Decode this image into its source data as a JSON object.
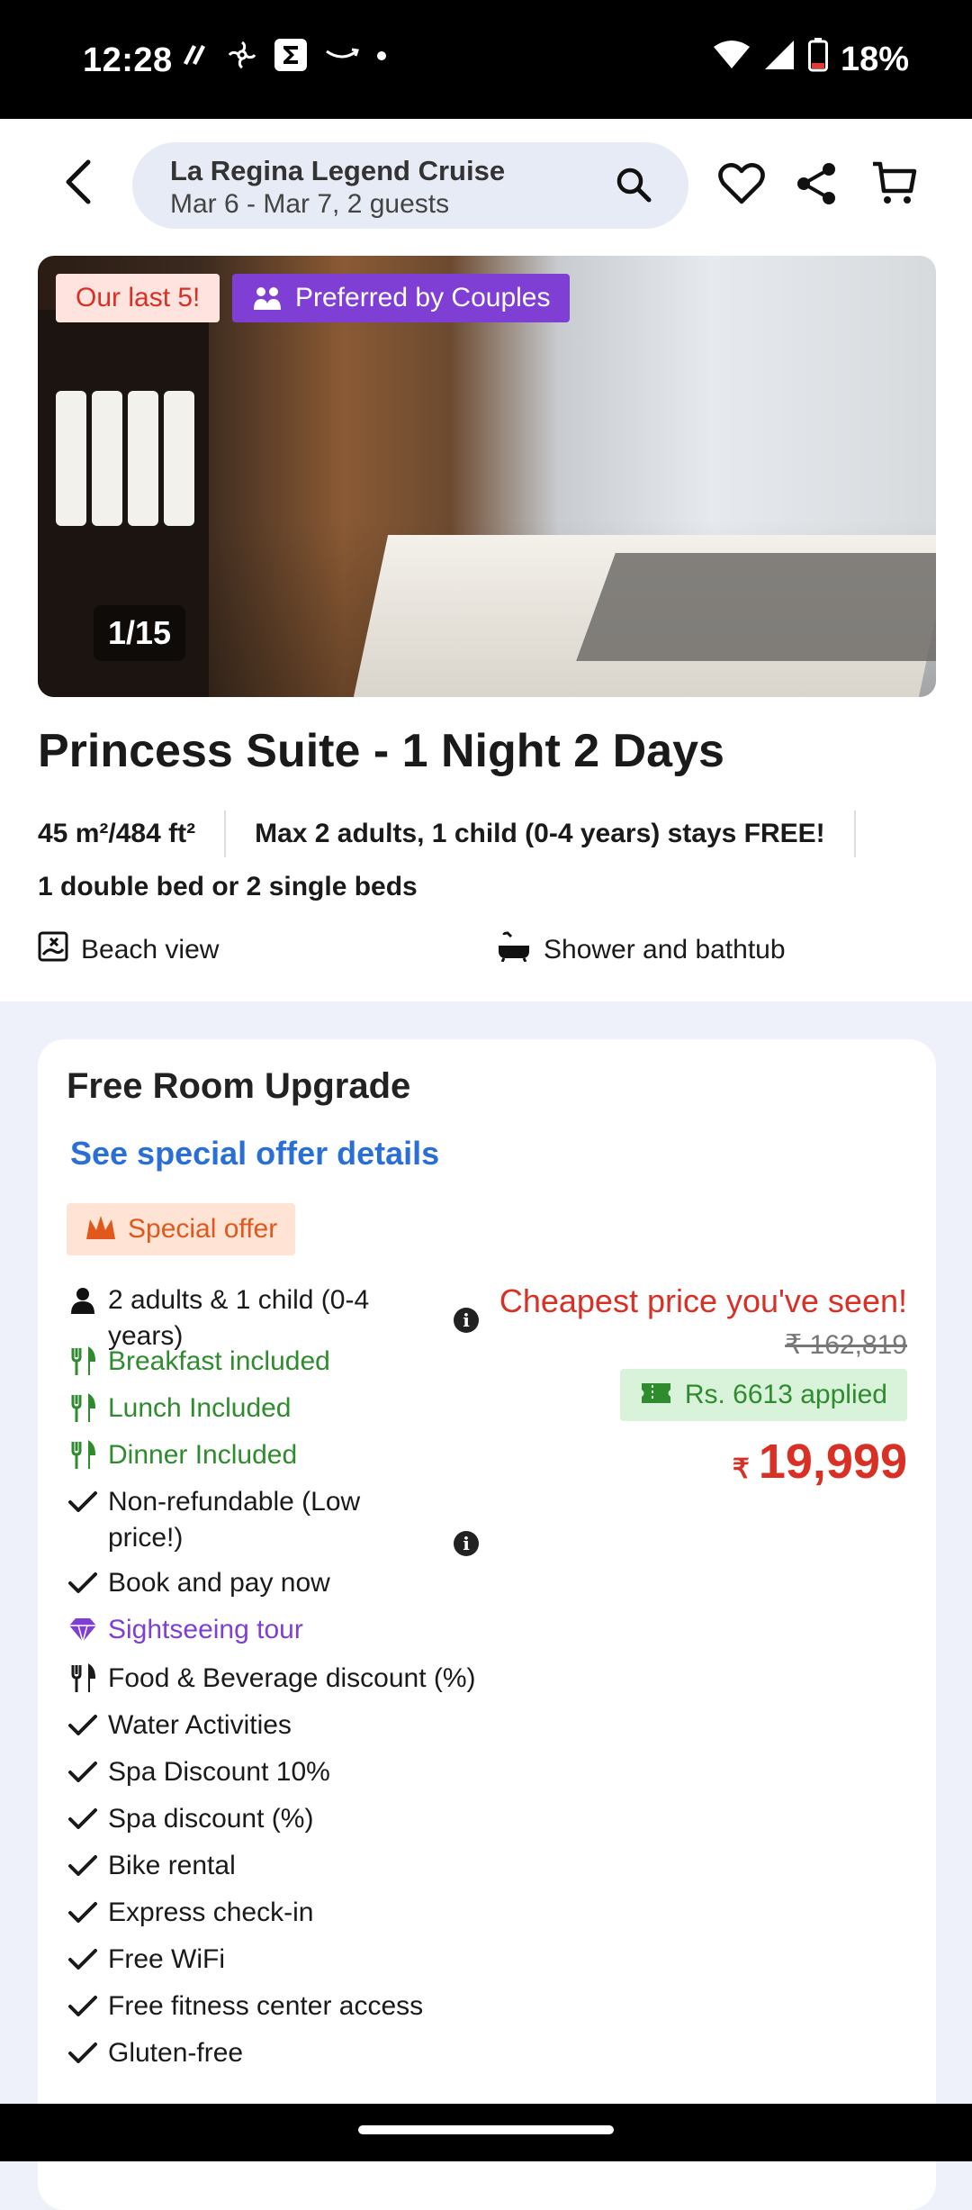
{
  "status_bar": {
    "time": "12:28",
    "battery": "18%",
    "icons": [
      "airtable-icon",
      "pinwheel-icon",
      "sigma-app-icon",
      "amazon-icon",
      "dot-icon",
      "wifi-icon",
      "signal-icon",
      "battery-low-icon"
    ]
  },
  "header": {
    "back_icon": "back-arrow-icon",
    "search_title": "La Regina Legend Cruise",
    "search_subtitle": "Mar 6 - Mar 7, 2 guests",
    "icons": [
      "search-icon",
      "heart-icon",
      "share-icon",
      "cart-icon"
    ]
  },
  "room": {
    "badge_last": "Our last 5!",
    "badge_couples": "Preferred by Couples",
    "photo_counter": "1/15",
    "title": "Princess Suite - 1 Night 2 Days",
    "size": "45 m²/484 ft²",
    "occupancy": "Max 2 adults, 1 child (0-4 years) stays FREE!",
    "beds": "1 double bed or 2 single beds",
    "amenities": [
      "Beach view",
      "Shower and bathtub"
    ]
  },
  "offer": {
    "title": "Free Room Upgrade",
    "details_link": "See special offer details",
    "badge": "Special offer",
    "guests": "2 adults & 1 child (0-4 years)",
    "features": [
      {
        "text": "Breakfast included",
        "icon": "cutlery-icon",
        "color": "#2e8b2e"
      },
      {
        "text": "Lunch Included",
        "icon": "cutlery-icon",
        "color": "#2e8b2e"
      },
      {
        "text": "Dinner Included",
        "icon": "cutlery-icon",
        "color": "#2e8b2e"
      },
      {
        "text": "Non-refundable (Low price!)",
        "icon": "check-icon",
        "color": "#1a1a1a"
      },
      {
        "text": "Book and pay now",
        "icon": "check-icon",
        "color": "#1a1a1a"
      },
      {
        "text": "Sightseeing tour",
        "icon": "diamond-icon",
        "color": "#7f3fd4"
      },
      {
        "text": "Food & Beverage discount (%)",
        "icon": "cutlery-icon",
        "color": "#1a1a1a"
      },
      {
        "text": "Water Activities",
        "icon": "check-icon",
        "color": "#1a1a1a"
      },
      {
        "text": "Spa Discount 10%",
        "icon": "check-icon",
        "color": "#1a1a1a"
      },
      {
        "text": "Spa discount (%)",
        "icon": "check-icon",
        "color": "#1a1a1a"
      },
      {
        "text": "Bike rental",
        "icon": "check-icon",
        "color": "#1a1a1a"
      },
      {
        "text": "Express check-in",
        "icon": "check-icon",
        "color": "#1a1a1a"
      },
      {
        "text": "Free WiFi",
        "icon": "check-icon",
        "color": "#1a1a1a"
      },
      {
        "text": "Free fitness center access",
        "icon": "check-icon",
        "color": "#1a1a1a"
      },
      {
        "text": "Gluten-free",
        "icon": "check-icon",
        "color": "#1a1a1a"
      }
    ],
    "cheapest_label": "Cheapest price you've seen!",
    "old_price": "₹ 162,819",
    "discount_applied": "Rs. 6613 applied",
    "price_currency": "₹",
    "price": "19,999"
  },
  "colors": {
    "accent_red": "#d93025",
    "link_blue": "#2a6fd6",
    "purple": "#7f3fd4",
    "green": "#2e8b2e"
  }
}
